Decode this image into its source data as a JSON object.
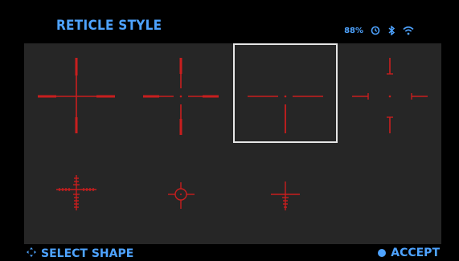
{
  "header": {
    "title": "RETICLE STYLE",
    "battery_text": "88%",
    "icons": [
      "timer-icon",
      "bluetooth-icon",
      "wifi-icon"
    ]
  },
  "reticles": {
    "options": [
      {
        "name": "reticle-style-1",
        "selected": false
      },
      {
        "name": "reticle-style-2",
        "selected": false
      },
      {
        "name": "reticle-style-3",
        "selected": true
      },
      {
        "name": "reticle-style-4",
        "selected": false
      },
      {
        "name": "reticle-style-5",
        "selected": false
      },
      {
        "name": "reticle-style-6",
        "selected": false
      },
      {
        "name": "reticle-style-7",
        "selected": false
      }
    ],
    "color": "#c81e1e"
  },
  "footer": {
    "select_label": "SELECT SHAPE",
    "accept_label": "ACCEPT"
  },
  "theme": {
    "accent": "#4ea3ff",
    "panel": "#262626",
    "background": "#000000",
    "selection": "#e6e6e6"
  }
}
